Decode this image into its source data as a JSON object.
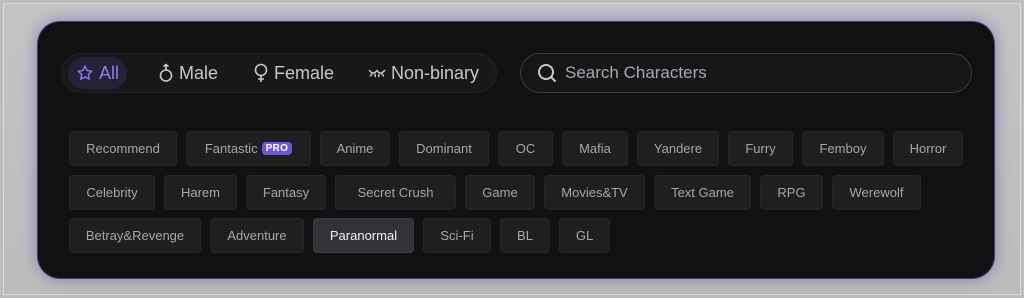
{
  "gender_filter": {
    "tabs": [
      {
        "label": "All",
        "icon": "star-icon",
        "active": true
      },
      {
        "label": "Male",
        "icon": "male-icon",
        "active": false
      },
      {
        "label": "Female",
        "icon": "female-icon",
        "active": false
      },
      {
        "label": "Non-binary",
        "icon": "nonbinary-icon",
        "active": false
      }
    ]
  },
  "search": {
    "placeholder": "Search Characters",
    "value": ""
  },
  "tags": {
    "rows": [
      [
        {
          "label": "Recommend"
        },
        {
          "label": "Fantastic",
          "badge": "PRO"
        },
        {
          "label": "Anime"
        },
        {
          "label": "Dominant"
        },
        {
          "label": "OC"
        },
        {
          "label": "Mafia"
        },
        {
          "label": "Yandere"
        },
        {
          "label": "Furry"
        },
        {
          "label": "Femboy"
        },
        {
          "label": "Horror"
        }
      ],
      [
        {
          "label": "Celebrity"
        },
        {
          "label": "Harem"
        },
        {
          "label": "Fantasy"
        },
        {
          "label": "Secret Crush"
        },
        {
          "label": "Game"
        },
        {
          "label": "Movies&TV"
        },
        {
          "label": "Text Game"
        },
        {
          "label": "RPG"
        },
        {
          "label": "Werewolf"
        }
      ],
      [
        {
          "label": "Betray&Revenge"
        },
        {
          "label": "Adventure"
        },
        {
          "label": "Paranormal",
          "selected": true
        },
        {
          "label": "Sci-Fi"
        },
        {
          "label": "BL"
        },
        {
          "label": "GL"
        }
      ]
    ]
  },
  "colors": {
    "accent": "#8e7cf2",
    "panel_bg": "#111113",
    "tag_bg": "#1f1f22",
    "tag_selected_bg": "#333337",
    "pro_badge": "#6b58d6"
  }
}
